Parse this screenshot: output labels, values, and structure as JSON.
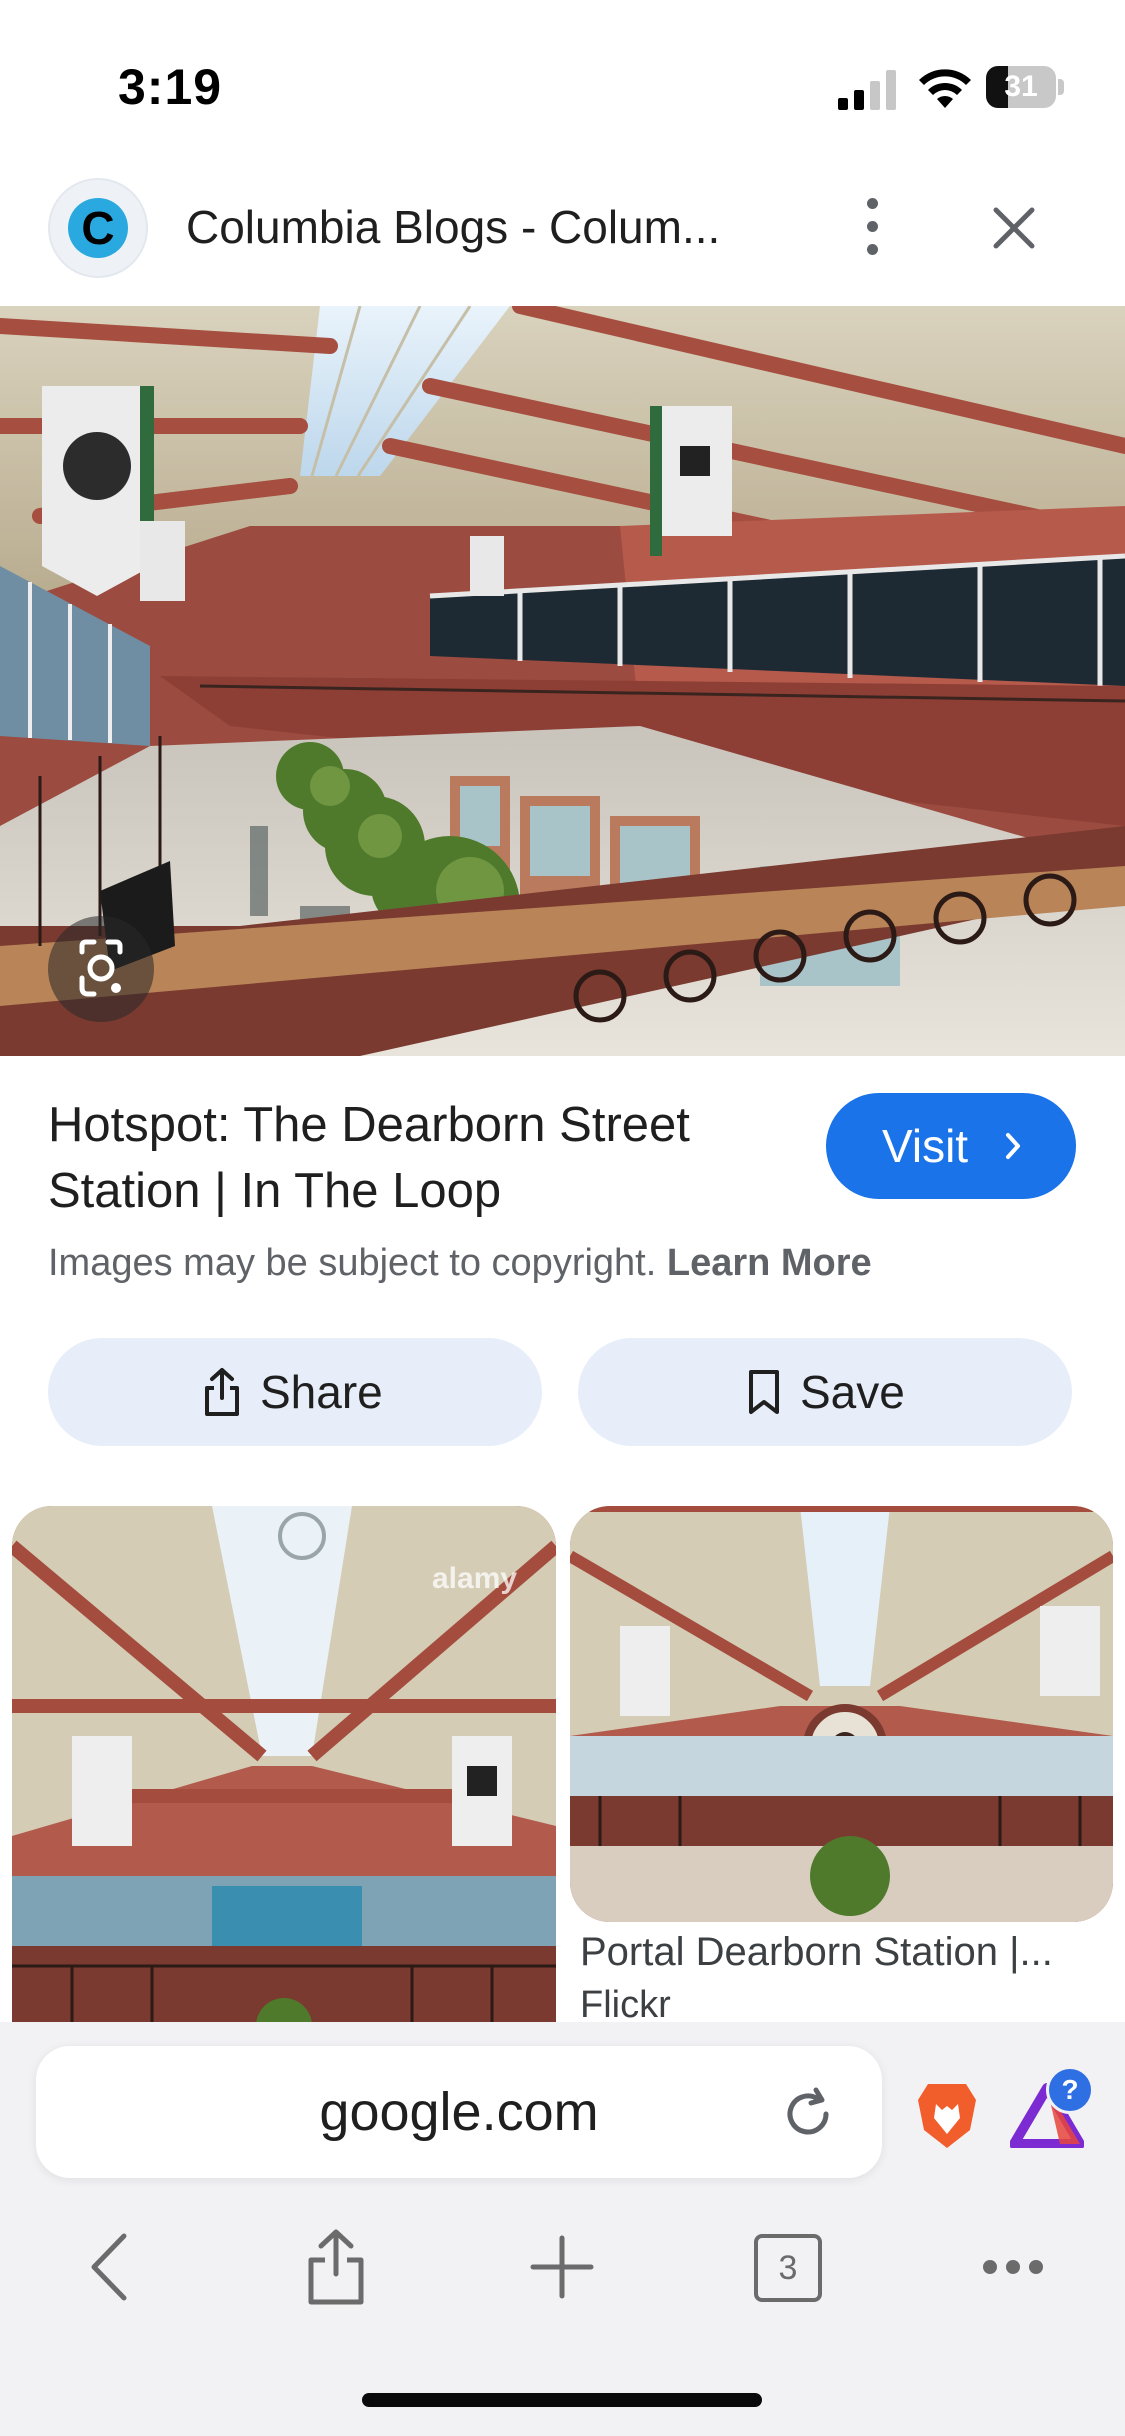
{
  "status_bar": {
    "time": "3:19",
    "battery_percent": "31",
    "battery_level": 0.31
  },
  "header": {
    "title": "Columbia Blogs - Colum...",
    "logo_letter": "C"
  },
  "result": {
    "title": "Hotspot: The Dearborn Street Station | In The Loop",
    "visit_label": "Visit",
    "copyright_text": "Images may be subject to copyright.",
    "learn_more": "Learn More"
  },
  "actions": {
    "share_label": "Share",
    "save_label": "Save"
  },
  "related": [
    {
      "watermark": "alamy"
    },
    {
      "caption": "Portal Dearborn Station |...",
      "source": "Flickr"
    }
  ],
  "browser": {
    "url": "google.com",
    "tab_count": "3",
    "rewards_badge": "?"
  },
  "icons": {
    "lens": "google-lens-icon",
    "reload": "reload-icon",
    "brave": "brave-lion-icon",
    "rewards": "brave-rewards-icon",
    "back": "chevron-left-icon",
    "share": "share-icon",
    "add": "plus-icon",
    "tabs": "tabs-icon",
    "menu": "more-horizontal-icon"
  },
  "colors": {
    "accent": "#1a73e8",
    "chip_bg": "#e8eef9",
    "wall": "#b5564a"
  }
}
